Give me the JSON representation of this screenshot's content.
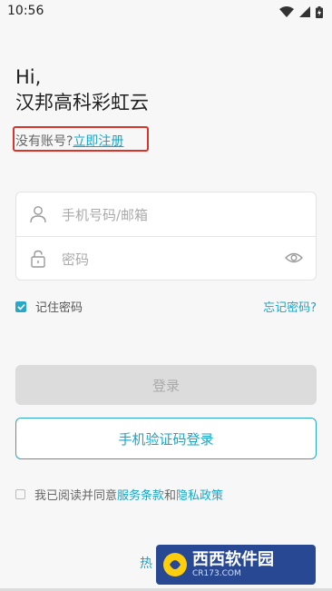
{
  "status_bar": {
    "time": "10:56"
  },
  "header": {
    "greeting": "Hi,",
    "app_name": "汉邦高科彩虹云"
  },
  "register": {
    "prompt": "没有账号?",
    "link_label": "立即注册"
  },
  "form": {
    "phone_placeholder": "手机号码/邮箱",
    "password_placeholder": "密码"
  },
  "remember": {
    "label": "记住密码",
    "checked": true
  },
  "forgot_label": "忘记密码?",
  "buttons": {
    "login_label": "登录",
    "sms_login_label": "手机验证码登录"
  },
  "agreement": {
    "prefix": "我已阅读并同意",
    "terms": "服务条款",
    "and": "和",
    "privacy": "隐私政策"
  },
  "hotline_partial": "热",
  "watermark": {
    "name": "西西软件园",
    "site": "CR173.COM"
  },
  "colors": {
    "accent": "#16a7c9",
    "highlight": "#d9342b"
  }
}
